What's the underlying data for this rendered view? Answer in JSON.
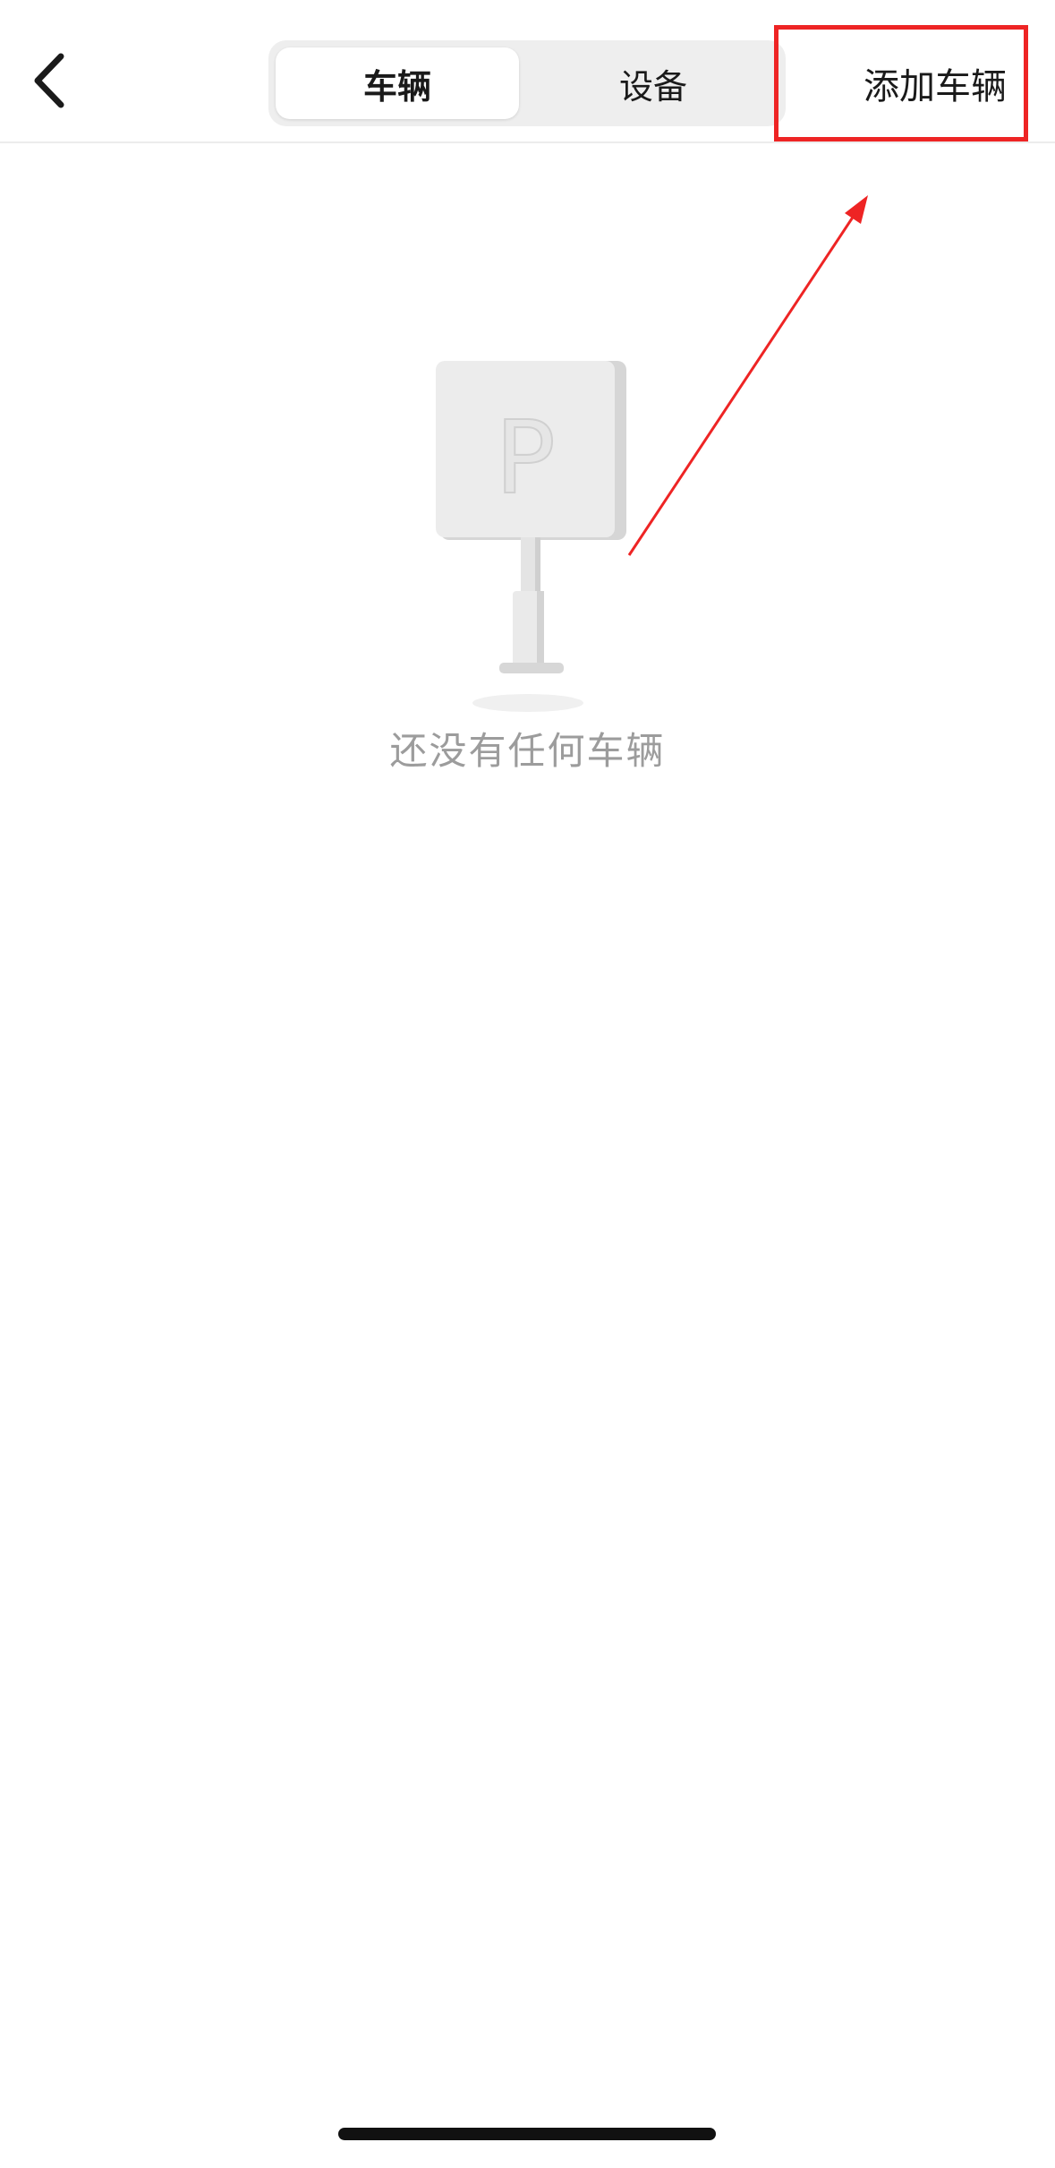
{
  "header": {
    "tabs": [
      {
        "label": "车辆",
        "active": true
      },
      {
        "label": "设备",
        "active": false
      }
    ],
    "add_button_label": "添加车辆"
  },
  "empty_state": {
    "message": "还没有任何车辆",
    "illustration_letter": "P"
  },
  "annotations": {
    "highlight_color": "#ee2424"
  },
  "icons": {
    "back": "chevron-left-icon",
    "empty": "parking-sign-icon"
  }
}
